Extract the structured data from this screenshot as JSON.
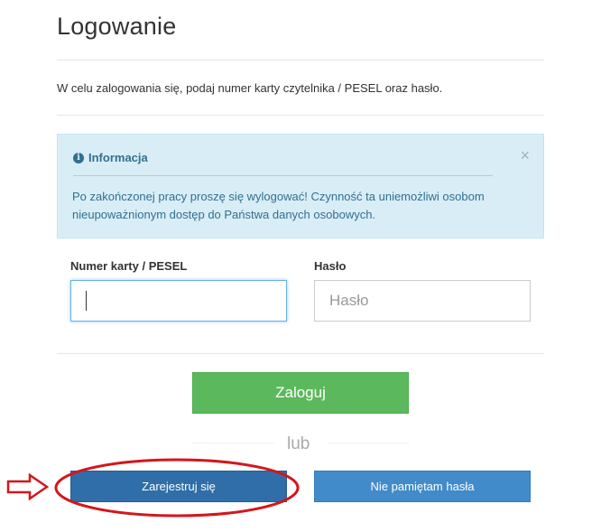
{
  "page": {
    "title": "Logowanie",
    "intro": "W celu zalogowania się, podaj numer karty czytelnika / PESEL oraz hasło."
  },
  "info": {
    "icon": "info-circle-icon",
    "title": "Informacja",
    "close_glyph": "×",
    "text": "Po zakończonej pracy proszę się wylogować! Czynność ta uniemożliwi osobom nieupoważnionym dostęp do Państwa danych osobowych."
  },
  "form": {
    "card_label": "Numer karty / PESEL",
    "card_value": "",
    "password_label": "Hasło",
    "password_placeholder": "Hasło"
  },
  "buttons": {
    "login": "Zaloguj",
    "or": "lub",
    "register": "Zarejestruj się",
    "forgot": "Nie pamiętam hasła"
  },
  "colors": {
    "login_bg": "#5cb85c",
    "register_bg": "#2f6ea8",
    "forgot_bg": "#428bca",
    "info_bg": "#d9edf7",
    "info_text": "#31708f",
    "annotation": "#d4161c"
  },
  "annotation": {
    "arrow_icon": "red-arrow-icon",
    "ellipse": "red-highlight-ellipse"
  }
}
